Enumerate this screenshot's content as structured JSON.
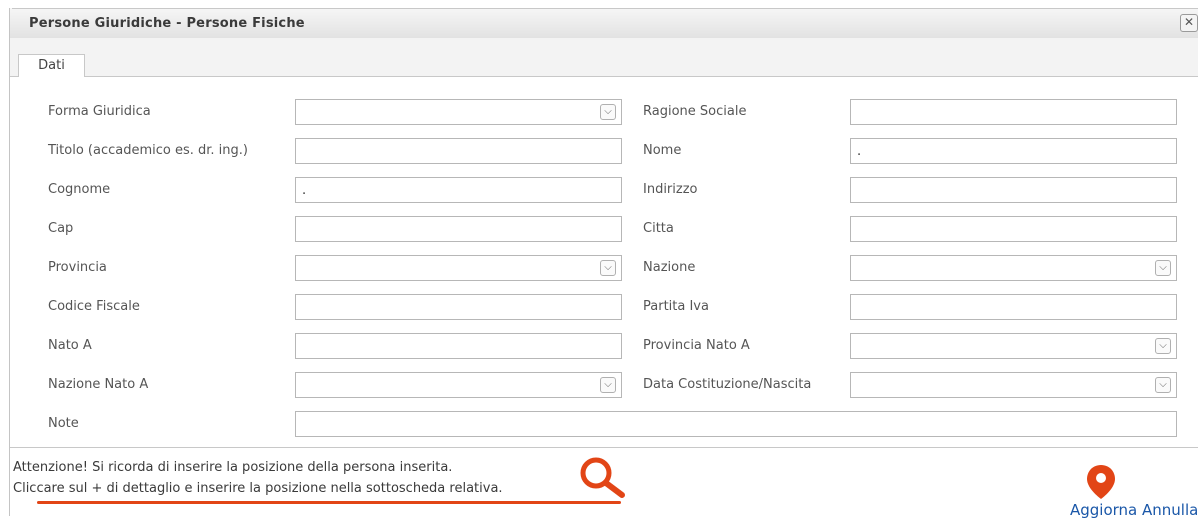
{
  "dialog": {
    "title": "Persone Giuridiche - Persone Fisiche",
    "close_icon": "close-icon"
  },
  "tabs": [
    {
      "label": "Dati",
      "selected": true
    }
  ],
  "form": {
    "forma_giuridica": {
      "label": "Forma Giuridica",
      "value": "",
      "type": "select"
    },
    "ragione_sociale": {
      "label": "Ragione Sociale",
      "value": "",
      "type": "text"
    },
    "titolo": {
      "label": "Titolo (accademico es. dr. ing.)",
      "value": "",
      "type": "text"
    },
    "nome": {
      "label": "Nome",
      "value": ".",
      "type": "text"
    },
    "cognome": {
      "label": "Cognome",
      "value": ".",
      "type": "text"
    },
    "indirizzo": {
      "label": "Indirizzo",
      "value": "",
      "type": "text"
    },
    "cap": {
      "label": "Cap",
      "value": "",
      "type": "text"
    },
    "citta": {
      "label": "Citta",
      "value": "",
      "type": "text"
    },
    "provincia": {
      "label": "Provincia",
      "value": "",
      "type": "select"
    },
    "nazione": {
      "label": "Nazione",
      "value": "",
      "type": "select"
    },
    "codice_fiscale": {
      "label": "Codice Fiscale",
      "value": "",
      "type": "text"
    },
    "partita_iva": {
      "label": "Partita Iva",
      "value": "",
      "type": "text"
    },
    "nato_a": {
      "label": "Nato A",
      "value": "",
      "type": "text"
    },
    "provincia_nato_a": {
      "label": "Provincia Nato A",
      "value": "",
      "type": "select"
    },
    "nazione_nato_a": {
      "label": "Nazione Nato A",
      "value": "",
      "type": "select"
    },
    "data_costituzione": {
      "label": "Data Costituzione/Nascita",
      "value": "",
      "type": "select"
    },
    "note": {
      "label": "Note",
      "value": "",
      "type": "text"
    }
  },
  "footer": {
    "warning_line1": "Attenzione! Si ricorda di inserire la posizione della persona inserita.",
    "warning_line2": "Cliccare sul + di dettaglio e inserire la posizione nella sottoscheda relativa.",
    "search_icon": "magnifier-icon",
    "pin_icon": "map-pin-icon",
    "action_label": "Aggiorna Annulla"
  },
  "colors": {
    "accent_orange": "#e24516",
    "link_blue": "#1a57a8"
  }
}
